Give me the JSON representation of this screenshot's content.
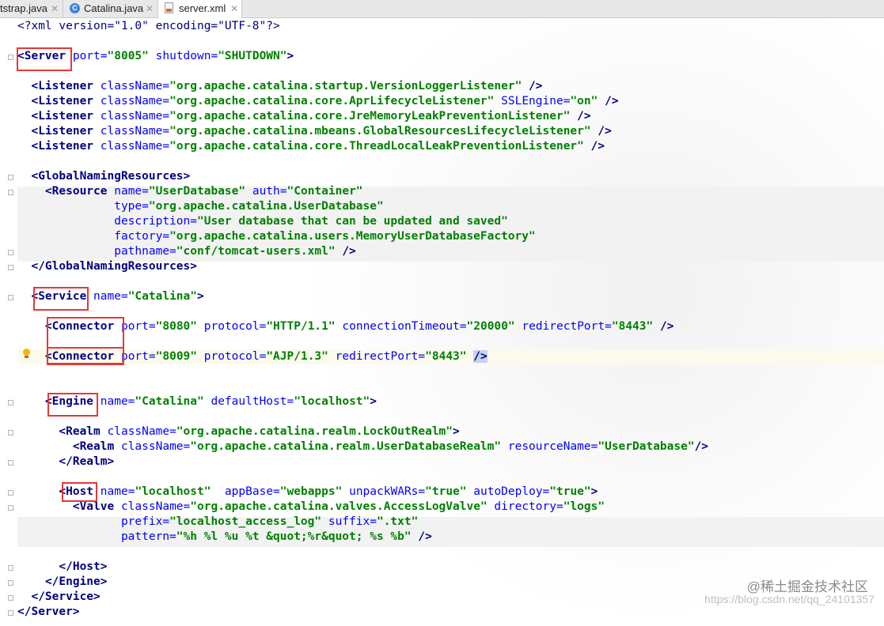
{
  "tabs": [
    {
      "label": "tstrap.java",
      "active": false
    },
    {
      "label": "Catalina.java",
      "active": false
    },
    {
      "label": "server.xml",
      "active": true
    }
  ],
  "code": {
    "l1": {
      "decl": "<?xml version=\"1.0\" encoding=\"UTF-8\"?>"
    },
    "server_open": {
      "tag": "<Server",
      "a1": "port=",
      "v1": "\"8005\"",
      "a2": "shutdown=",
      "v2": "\"SHUTDOWN\"",
      "end": ">"
    },
    "listeners": [
      {
        "tag": "<Listener",
        "a1": "className=",
        "v1": "\"org.apache.catalina.startup.VersionLoggerListener\"",
        "end": "/>"
      },
      {
        "tag": "<Listener",
        "a1": "className=",
        "v1": "\"org.apache.catalina.core.AprLifecycleListener\"",
        "a2": "SSLEngine=",
        "v2": "\"on\"",
        "end": "/>"
      },
      {
        "tag": "<Listener",
        "a1": "className=",
        "v1": "\"org.apache.catalina.core.JreMemoryLeakPreventionListener\"",
        "end": "/>"
      },
      {
        "tag": "<Listener",
        "a1": "className=",
        "v1": "\"org.apache.catalina.mbeans.GlobalResourcesLifecycleListener\"",
        "end": "/>"
      },
      {
        "tag": "<Listener",
        "a1": "className=",
        "v1": "\"org.apache.catalina.core.ThreadLocalLeakPreventionListener\"",
        "end": "/>"
      }
    ],
    "gnr_open": "<GlobalNamingResources>",
    "resource": {
      "tag": "<Resource",
      "name_a": "name=",
      "name_v": "\"UserDatabase\"",
      "auth_a": "auth=",
      "auth_v": "\"Container\"",
      "type_a": "type=",
      "type_v": "\"org.apache.catalina.UserDatabase\"",
      "desc_a": "description=",
      "desc_v": "\"User database that can be updated and saved\"",
      "fact_a": "factory=",
      "fact_v": "\"org.apache.catalina.users.MemoryUserDatabaseFactory\"",
      "path_a": "pathname=",
      "path_v": "\"conf/tomcat-users.xml\"",
      "end": "/>"
    },
    "gnr_close": "</GlobalNamingResources>",
    "service": {
      "tag": "<Service",
      "a1": "name=",
      "v1": "\"Catalina\"",
      "end": ">"
    },
    "connector1": {
      "tag": "<Connector",
      "a1": "port=",
      "v1": "\"8080\"",
      "a2": "protocol=",
      "v2": "\"HTTP/1.1\"",
      "a3": "connectionTimeout=",
      "v3": "\"20000\"",
      "a4": "redirectPort=",
      "v4": "\"8443\"",
      "end": "/>"
    },
    "connector2": {
      "tag": "<Connector",
      "a1": "port=",
      "v1": "\"8009\"",
      "a2": "protocol=",
      "v2": "\"AJP/1.3\"",
      "a3": "redirectPort=",
      "v3": "\"8443\"",
      "end": "/>"
    },
    "engine": {
      "tag": "<Engine",
      "a1": "name=",
      "v1": "\"Catalina\"",
      "a2": "defaultHost=",
      "v2": "\"localhost\"",
      "end": ">"
    },
    "realm1": {
      "tag": "<Realm",
      "a1": "className=",
      "v1": "\"org.apache.catalina.realm.LockOutRealm\"",
      "end": ">"
    },
    "realm2": {
      "tag": "<Realm",
      "a1": "className=",
      "v1": "\"org.apache.catalina.realm.UserDatabaseRealm\"",
      "a2": "resourceName=",
      "v2": "\"UserDatabase\"",
      "end": "/>"
    },
    "realm_close": "</Realm>",
    "host": {
      "tag": "<Host",
      "a1": "name=",
      "v1": "\"localhost\"",
      "a2": "appBase=",
      "v2": "\"webapps\"",
      "a3": "unpackWARs=",
      "v3": "\"true\"",
      "a4": "autoDeploy=",
      "v4": "\"true\"",
      "end": ">"
    },
    "valve": {
      "tag": "<Valve",
      "a1": "className=",
      "v1": "\"org.apache.catalina.valves.AccessLogValve\"",
      "a2": "directory=",
      "v2": "\"logs\"",
      "a3": "prefix=",
      "v3": "\"localhost_access_log\"",
      "a4": "suffix=",
      "v4": "\".txt\"",
      "a5": "pattern=",
      "v5": "\"%h %l %u %t &quot;%r&quot; %s %b\"",
      "end": "/>"
    },
    "host_close": "</Host>",
    "engine_close": "</Engine>",
    "service_close": "</Service>",
    "server_close": "</Server>"
  },
  "watermark": {
    "line1": "@稀土掘金技术社区",
    "line2": "https://blog.csdn.net/qq_24101357"
  },
  "colors": {
    "tag": "#000080",
    "attr": "#0000ff",
    "value": "#008000",
    "highlight_box": "#e53935"
  }
}
